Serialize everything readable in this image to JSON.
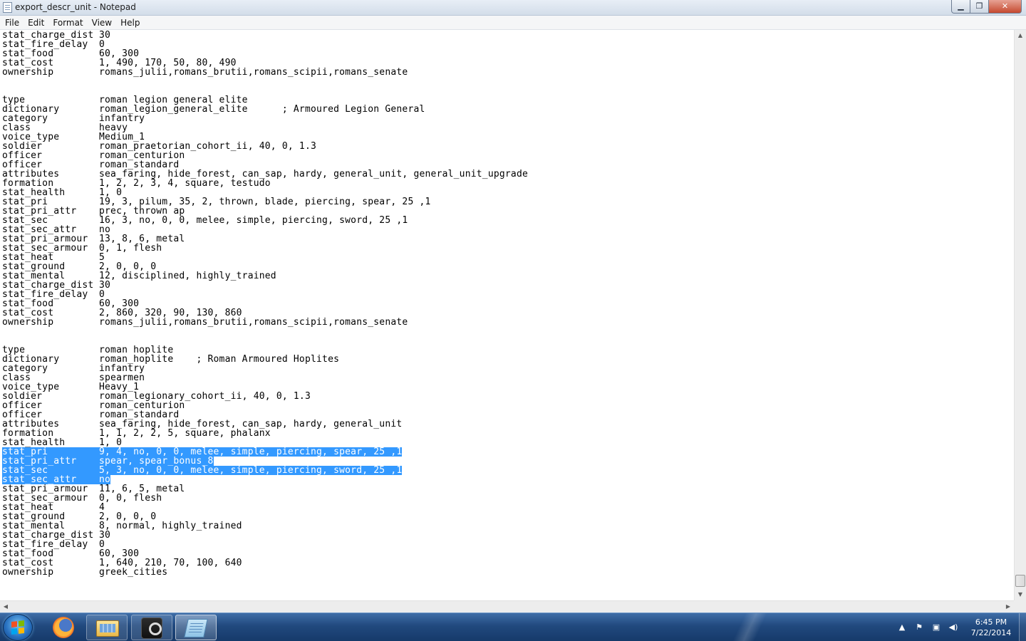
{
  "window": {
    "title": "export_descr_unit - Notepad",
    "minimize_glyph": "▁",
    "maximize_glyph": "❐",
    "close_glyph": "✕"
  },
  "menu": [
    "File",
    "Edit",
    "Format",
    "View",
    "Help"
  ],
  "editor": {
    "selection_color": "#3399ff",
    "lines": [
      {
        "k": "stat_charge_dist",
        "v": "30"
      },
      {
        "k": "stat_fire_delay",
        "v": "0"
      },
      {
        "k": "stat_food",
        "v": "60, 300"
      },
      {
        "k": "stat_cost",
        "v": "1, 490, 170, 50, 80, 490"
      },
      {
        "k": "ownership",
        "v": "romans_julii,romans_brutii,romans_scipii,romans_senate"
      },
      {
        "k": "",
        "v": ""
      },
      {
        "k": "",
        "v": ""
      },
      {
        "k": "type",
        "v": "roman legion general elite"
      },
      {
        "k": "dictionary",
        "v": "roman_legion_general_elite      ; Armoured Legion General"
      },
      {
        "k": "category",
        "v": "infantry"
      },
      {
        "k": "class",
        "v": "heavy"
      },
      {
        "k": "voice_type",
        "v": "Medium_1"
      },
      {
        "k": "soldier",
        "v": "roman_praetorian_cohort_ii, 40, 0, 1.3"
      },
      {
        "k": "officer",
        "v": "roman_centurion"
      },
      {
        "k": "officer",
        "v": "roman_standard"
      },
      {
        "k": "attributes",
        "v": "sea_faring, hide_forest, can_sap, hardy, general_unit, general_unit_upgrade"
      },
      {
        "k": "formation",
        "v": "1, 2, 2, 3, 4, square, testudo"
      },
      {
        "k": "stat_health",
        "v": "1, 0"
      },
      {
        "k": "stat_pri",
        "v": "19, 3, pilum, 35, 2, thrown, blade, piercing, spear, 25 ,1"
      },
      {
        "k": "stat_pri_attr",
        "v": "prec, thrown ap"
      },
      {
        "k": "stat_sec",
        "v": "16, 3, no, 0, 0, melee, simple, piercing, sword, 25 ,1"
      },
      {
        "k": "stat_sec_attr",
        "v": "no"
      },
      {
        "k": "stat_pri_armour",
        "v": "13, 8, 6, metal"
      },
      {
        "k": "stat_sec_armour",
        "v": "0, 1, flesh"
      },
      {
        "k": "stat_heat",
        "v": "5"
      },
      {
        "k": "stat_ground",
        "v": "2, 0, 0, 0"
      },
      {
        "k": "stat_mental",
        "v": "12, disciplined, highly_trained"
      },
      {
        "k": "stat_charge_dist",
        "v": "30"
      },
      {
        "k": "stat_fire_delay",
        "v": "0"
      },
      {
        "k": "stat_food",
        "v": "60, 300"
      },
      {
        "k": "stat_cost",
        "v": "2, 860, 320, 90, 130, 860"
      },
      {
        "k": "ownership",
        "v": "romans_julii,romans_brutii,romans_scipii,romans_senate"
      },
      {
        "k": "",
        "v": ""
      },
      {
        "k": "",
        "v": ""
      },
      {
        "k": "type",
        "v": "roman hoplite"
      },
      {
        "k": "dictionary",
        "v": "roman_hoplite    ; Roman Armoured Hoplites"
      },
      {
        "k": "category",
        "v": "infantry"
      },
      {
        "k": "class",
        "v": "spearmen"
      },
      {
        "k": "voice_type",
        "v": "Heavy_1"
      },
      {
        "k": "soldier",
        "v": "roman_legionary_cohort_ii, 40, 0, 1.3"
      },
      {
        "k": "officer",
        "v": "roman_centurion"
      },
      {
        "k": "officer",
        "v": "roman_standard"
      },
      {
        "k": "attributes",
        "v": "sea_faring, hide_forest, can_sap, hardy, general_unit"
      },
      {
        "k": "formation",
        "v": "1, 1, 2, 2, 5, square, phalanx"
      },
      {
        "k": "stat_health",
        "v": "1, 0"
      },
      {
        "k": "stat_pri",
        "v": "9, 4, no, 0, 0, melee, simple, piercing, spear, 25 ,1",
        "selected": true
      },
      {
        "k": "stat_pri_attr",
        "v": "spear, spear_bonus_8",
        "selected": true
      },
      {
        "k": "stat_sec",
        "v": "5, 3, no, 0, 0, melee, simple, piercing, sword, 25 ,1",
        "selected": true
      },
      {
        "k": "stat_sec_attr",
        "v": "no",
        "selected": true
      },
      {
        "k": "stat_pri_armour",
        "v": "11, 6, 5, metal"
      },
      {
        "k": "stat_sec_armour",
        "v": "0, 0, flesh"
      },
      {
        "k": "stat_heat",
        "v": "4"
      },
      {
        "k": "stat_ground",
        "v": "2, 0, 0, 0"
      },
      {
        "k": "stat_mental",
        "v": "8, normal, highly_trained"
      },
      {
        "k": "stat_charge_dist",
        "v": "30"
      },
      {
        "k": "stat_fire_delay",
        "v": "0"
      },
      {
        "k": "stat_food",
        "v": "60, 300"
      },
      {
        "k": "stat_cost",
        "v": "1, 640, 210, 70, 100, 640"
      },
      {
        "k": "ownership",
        "v": "greek_cities"
      }
    ]
  },
  "scrollbar": {
    "up_glyph": "▲",
    "down_glyph": "▼",
    "left_glyph": "◀",
    "right_glyph": "▶"
  },
  "taskbar": {
    "apps": [
      {
        "name": "firefox-icon"
      },
      {
        "name": "explorer-icon"
      },
      {
        "name": "steam-icon"
      },
      {
        "name": "notepad-icon"
      }
    ],
    "tray": {
      "arrow_glyph": "▲",
      "flag_glyph": "⚑",
      "network_glyph": "▣",
      "volume_glyph": "◀)"
    },
    "clock": {
      "time": "6:45 PM",
      "date": "7/22/2014"
    }
  }
}
